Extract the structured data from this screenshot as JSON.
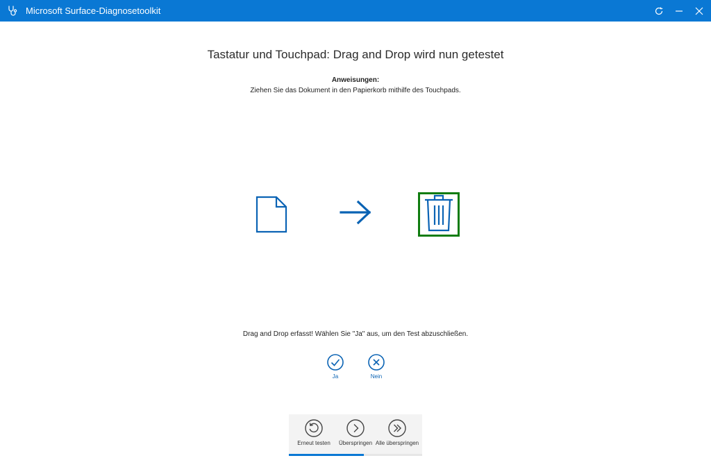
{
  "window": {
    "title": "Microsoft Surface-Diagnosetoolkit",
    "app_icon": "stethoscope-icon",
    "controls": [
      "refresh-icon",
      "minimize-icon",
      "close-icon"
    ]
  },
  "test": {
    "heading": "Tastatur und Touchpad: Drag and Drop wird nun getestet",
    "instructions_title": "Anweisungen:",
    "instructions_text": "Ziehen Sie das Dokument in den Papierkorb mithilfe des Touchpads.",
    "illustration": [
      "document-icon",
      "arrow-right-icon",
      "trash-icon"
    ]
  },
  "result": {
    "status_text": "Drag and Drop erfasst! Wählen Sie \"Ja\" aus, um den Test abzuschließen.",
    "yes_label": "Ja",
    "no_label": "Nein"
  },
  "bottom_bar": {
    "retest_label": "Erneut testen",
    "skip_label": "Überspringen",
    "skip_all_label": "Alle überspringen",
    "progress_fraction": 0.56
  },
  "colors": {
    "accent": "#0a78d4",
    "target_border": "#107c10",
    "icon_blue": "#0a63b4"
  }
}
